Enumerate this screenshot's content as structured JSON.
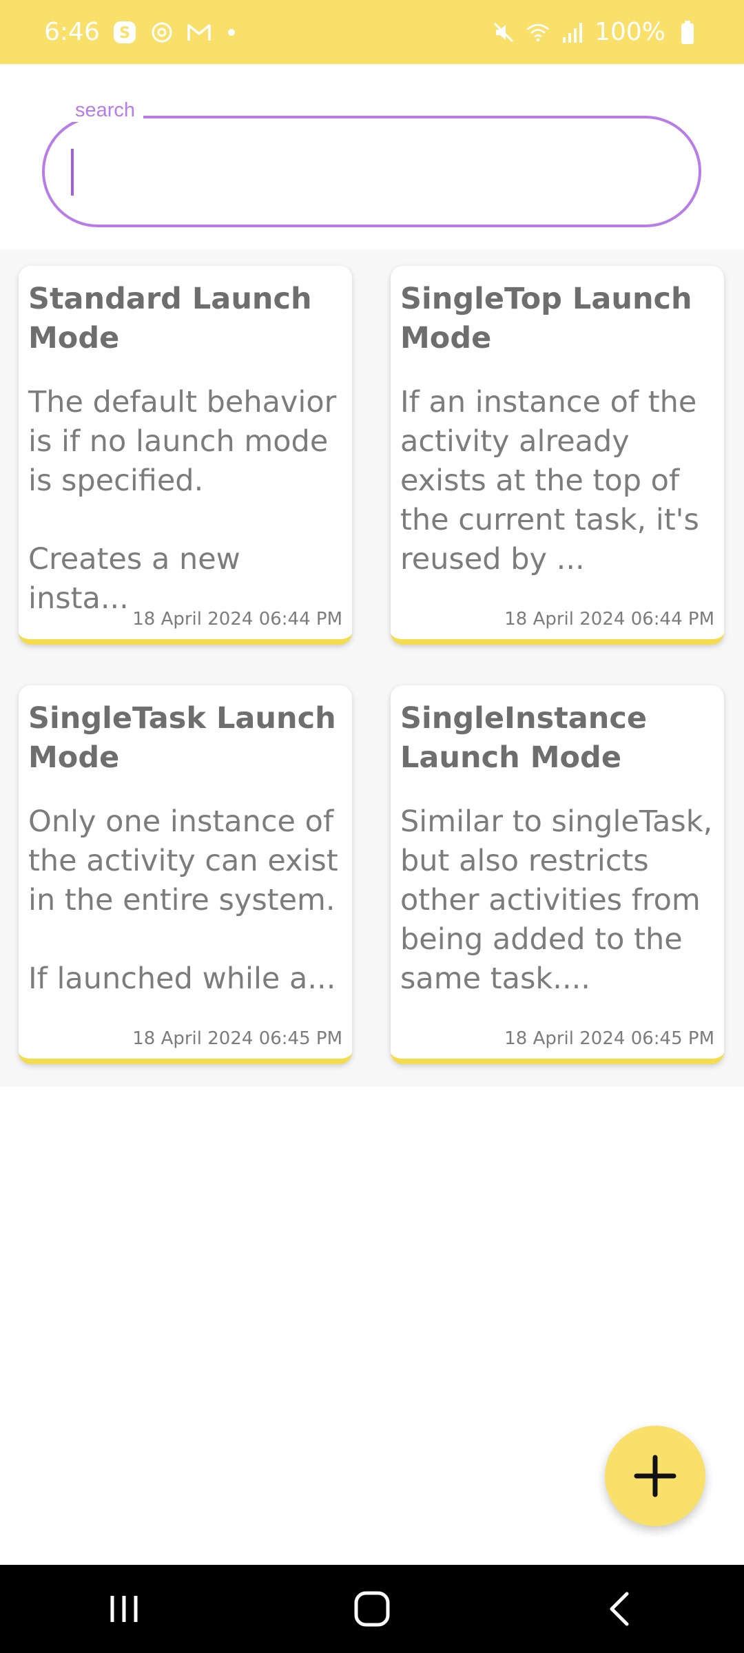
{
  "status_bar": {
    "time": "6:46",
    "battery": "100%",
    "icons": [
      "skype-icon",
      "sync-icon",
      "gmail-icon",
      "dot-icon",
      "mute-icon",
      "wifi-icon",
      "signal-icon",
      "battery-icon"
    ]
  },
  "search": {
    "label": "search",
    "value": "",
    "placeholder": ""
  },
  "notes": [
    {
      "title": "Standard Launch Mode",
      "body": "The default behavior is if no launch mode is specified.\n\nCreates a new insta...",
      "date": "18 April 2024 06:44 PM"
    },
    {
      "title": "SingleTop Launch Mode",
      "body": "If an instance of the activity already exists at the top of the current task, it's reused by ...",
      "date": "18 April 2024 06:44 PM"
    },
    {
      "title": "SingleTask Launch Mode",
      "body": "Only one instance of the activity can exist in the entire system.\n\nIf launched while a...",
      "date": "18 April 2024 06:45 PM"
    },
    {
      "title": "SingleInstance Launch Mode",
      "body": "Similar to singleTask, but also restricts other activities from being added to the same task....",
      "date": "18 April 2024 06:45 PM"
    }
  ],
  "fab": {
    "icon": "plus-icon"
  },
  "nav": {
    "icons": [
      "recents-icon",
      "home-icon",
      "back-icon"
    ]
  },
  "colors": {
    "accent_yellow": "#f9e06a",
    "search_border": "#b77ce8",
    "card_underline": "#f4dc4c"
  }
}
